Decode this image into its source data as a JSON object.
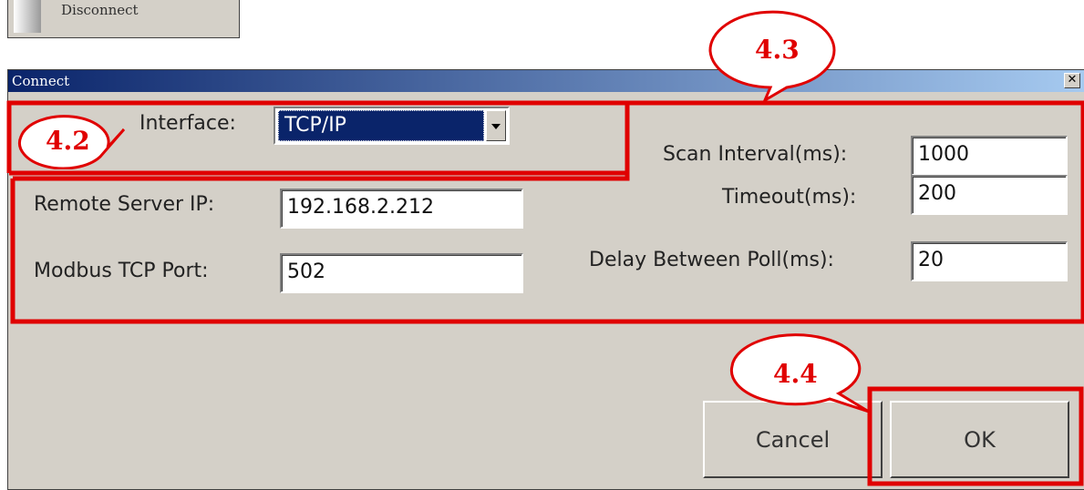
{
  "menu": {
    "disconnect_label": "Disconnect"
  },
  "dialog": {
    "title": "Connect",
    "close_glyph": "✕",
    "interface": {
      "label": "Interface:",
      "value": "TCP/IP"
    },
    "remote_ip": {
      "label": "Remote Server IP:",
      "value": "192.168.2.212"
    },
    "port": {
      "label": "Modbus TCP Port:",
      "value": "502"
    },
    "scan_interval": {
      "label": "Scan Interval(ms):",
      "value": "1000"
    },
    "timeout": {
      "label": "Timeout(ms):",
      "value": "200"
    },
    "delay": {
      "label": "Delay Between Poll(ms):",
      "value": "20"
    },
    "cancel_label": "Cancel",
    "ok_label": "OK"
  },
  "callouts": {
    "c42": "4.2",
    "c43": "4.3",
    "c44": "4.4"
  },
  "colors": {
    "annotation": "#e00000",
    "titlebar": "#0a246a",
    "dialog_face": "#d4d0c8"
  }
}
